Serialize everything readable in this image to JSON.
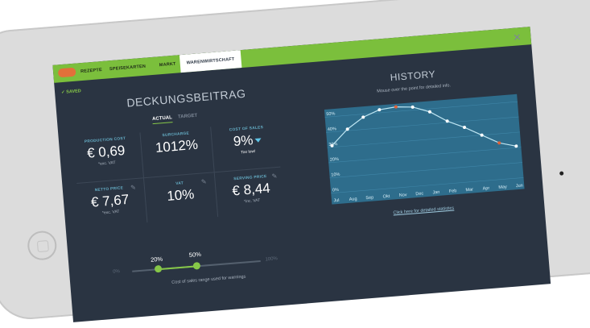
{
  "nav": {
    "items": [
      "REZEPTE",
      "SPEISEKARTEN",
      "MARKT",
      "WARENWIRTSCHAFT"
    ],
    "active": "WARENWIRTSCHAFT"
  },
  "status": {
    "saved": "✓ SAVED"
  },
  "title": "DECKUNGSBEITRAG",
  "tabs": {
    "actual": "ACTUAL",
    "target": "TARGET"
  },
  "metrics": {
    "production_cost": {
      "label": "PRODUCTION COST",
      "value": "€ 0,69",
      "sub": "*exc. VAT"
    },
    "surcharge": {
      "label": "SURCHARGE",
      "value": "1012%"
    },
    "cost_of_sales": {
      "label": "COST OF SALES",
      "value": "9%",
      "sub": "Too low!"
    },
    "netto_price": {
      "label": "NETTO PRICE",
      "value": "€ 7,67",
      "sub": "*exc. VAT"
    },
    "vat": {
      "label": "VAT",
      "value": "10%"
    },
    "serving_price": {
      "label": "SERVING PRICE",
      "value": "€ 8,44",
      "sub": "*inc. VAT"
    }
  },
  "range": {
    "min_label": "0%",
    "max_label": "100%",
    "low_label": "20%",
    "high_label": "50%",
    "low": 20,
    "high": 50,
    "caption": "Cost of sales range used for warnings"
  },
  "history": {
    "title": "HISTORY",
    "subtitle": "Mouse over the point for detailed info.",
    "link": "Click here for detailed statistics"
  },
  "colors": {
    "accent": "#7bbf3c",
    "panel": "#2a3442",
    "chart_bg": "#2e6d8c",
    "line": "#bfe6f3",
    "highlight_point": "#e0623a"
  },
  "chart_data": {
    "type": "line",
    "categories": [
      "Jul",
      "Aug",
      "Sep",
      "Okt",
      "Nov",
      "Dec",
      "Jan",
      "Feb",
      "Mar",
      "Apr",
      "May",
      "Jun"
    ],
    "series": [
      {
        "values": [
          31,
          41,
          48,
          52,
          53,
          52,
          48,
          41,
          36,
          30,
          24,
          21
        ]
      }
    ],
    "highlighted": [
      4,
      10
    ],
    "y_ticks": [
      "0%",
      "10%",
      "20%",
      "30%",
      "40%",
      "50%"
    ],
    "ylim": [
      0,
      55
    ],
    "grid": true
  }
}
